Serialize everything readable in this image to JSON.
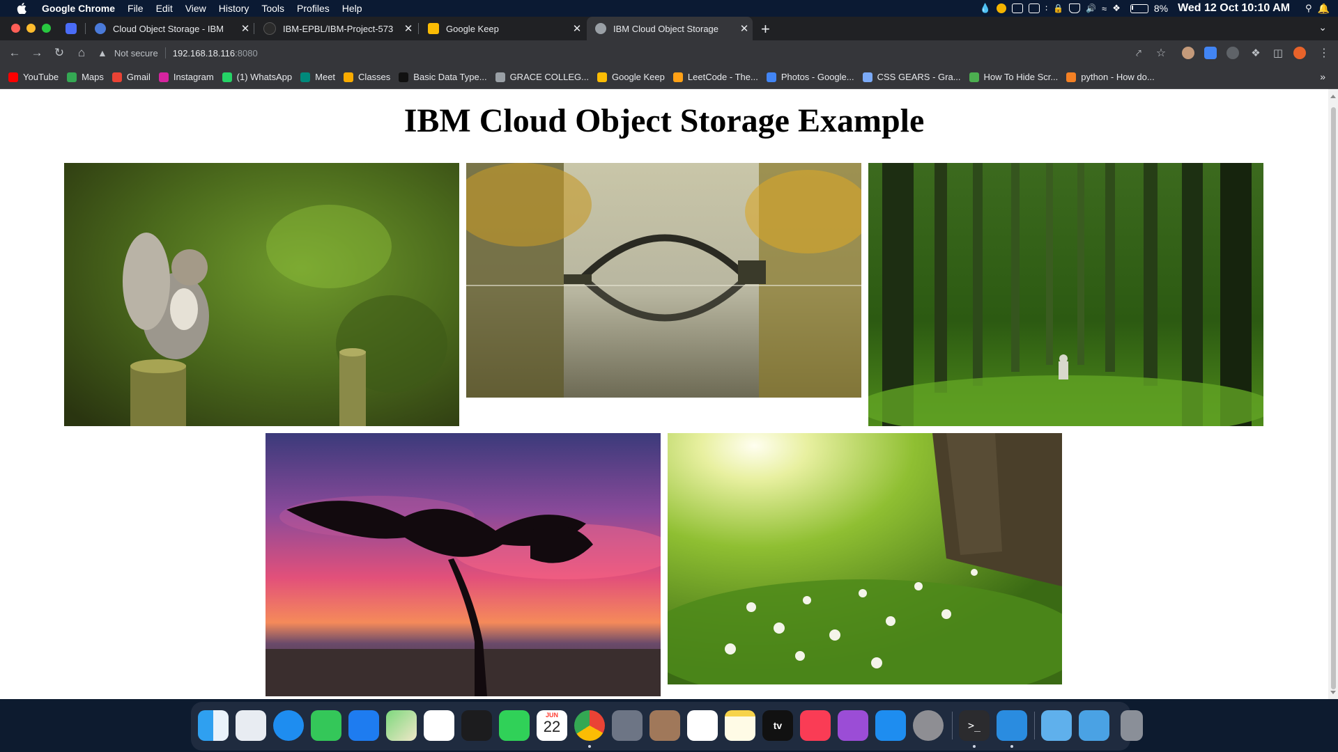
{
  "menubar": {
    "app_name": "Google Chrome",
    "items": [
      "File",
      "Edit",
      "View",
      "History",
      "Tools",
      "Profiles",
      "Help"
    ],
    "battery": "8%",
    "clock": "Wed 12 Oct  10:10 AM"
  },
  "tabs": [
    {
      "title": "Cloud Object Storage - IBM",
      "active": false
    },
    {
      "title": "IBM-EPBL/IBM-Project-573",
      "active": false
    },
    {
      "title": "Google Keep",
      "active": false
    },
    {
      "title": "IBM Cloud Object Storage",
      "active": true
    }
  ],
  "toolbar": {
    "security_label": "Not secure",
    "url_host": "192.168.18.116",
    "url_port": ":8080"
  },
  "bookmarks": [
    {
      "label": "YouTube",
      "color": "#ff0000"
    },
    {
      "label": "Maps",
      "color": "#34a853"
    },
    {
      "label": "Gmail",
      "color": "#ea4335"
    },
    {
      "label": "Instagram",
      "color": "#d6249f"
    },
    {
      "label": "(1) WhatsApp",
      "color": "#25d366"
    },
    {
      "label": "Meet",
      "color": "#00897b"
    },
    {
      "label": "Classes",
      "color": "#f9ab00"
    },
    {
      "label": "Basic Data Type...",
      "color": "#111111"
    },
    {
      "label": "GRACE COLLEG...",
      "color": "#9aa0a6"
    },
    {
      "label": "Google Keep",
      "color": "#fbbc04"
    },
    {
      "label": "LeetCode - The...",
      "color": "#ffa116"
    },
    {
      "label": "Photos - Google...",
      "color": "#4285f4"
    },
    {
      "label": "CSS GEARS - Gra...",
      "color": "#7baaf7"
    },
    {
      "label": "How To Hide Scr...",
      "color": "#4caf50"
    },
    {
      "label": "python - How do...",
      "color": "#f48024"
    }
  ],
  "page": {
    "title": "IBM Cloud Object Storage Example"
  },
  "gallery": [
    {
      "subject": "squirrel on tree stump"
    },
    {
      "subject": "arched stone bridge reflected in lake"
    },
    {
      "subject": "green forest with person walking"
    },
    {
      "subject": "tree silhouette at sunset"
    },
    {
      "subject": "white flowers beside tree trunk in sunlight"
    }
  ],
  "dock": {
    "calendar_month": "JUN",
    "calendar_day": "22",
    "tv_label": "tv"
  }
}
